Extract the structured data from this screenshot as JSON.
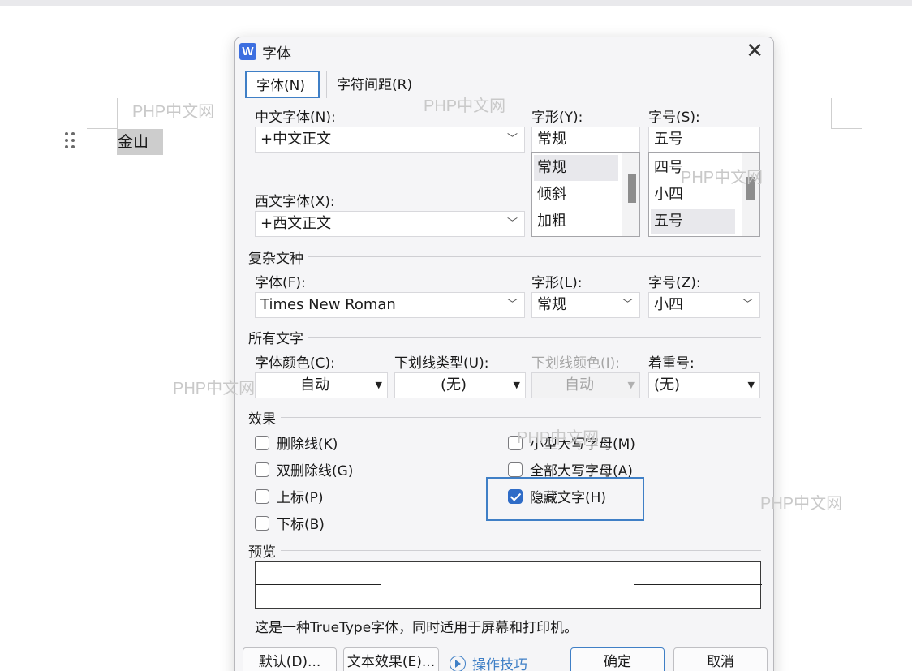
{
  "document": {
    "text": "金山"
  },
  "watermarks": [
    "PHP中文网",
    "PHP中文网",
    "PHP中文网",
    "PHP中文网",
    "PHP中文网",
    "PHP中文网"
  ],
  "dialog": {
    "app_icon": "W",
    "title": "字体",
    "tabs": [
      {
        "label": "字体(N)",
        "active": true
      },
      {
        "label": "字符间距(R)",
        "active": false
      }
    ],
    "chinese_font": {
      "label": "中文字体(N):",
      "value": "+中文正文"
    },
    "font_style": {
      "label": "字形(Y):",
      "value": "常规",
      "options": [
        "常规",
        "倾斜",
        "加粗"
      ],
      "selected": "常规"
    },
    "font_size": {
      "label": "字号(S):",
      "value": "五号",
      "options": [
        "四号",
        "小四",
        "五号"
      ],
      "selected": "五号"
    },
    "western_font": {
      "label": "西文字体(X):",
      "value": "+西文正文"
    },
    "complex": {
      "section": "复杂文种",
      "font_label": "字体(F):",
      "font_value": "Times New Roman",
      "style_label": "字形(L):",
      "style_value": "常规",
      "size_label": "字号(Z):",
      "size_value": "小四"
    },
    "all_text": {
      "section": "所有文字",
      "color_label": "字体颜色(C):",
      "color_value": "自动",
      "underline_label": "下划线类型(U):",
      "underline_value": "(无)",
      "underline_color_label": "下划线颜色(I):",
      "underline_color_value": "自动",
      "emphasis_label": "着重号:",
      "emphasis_value": "(无)"
    },
    "effects": {
      "section": "效果",
      "items": [
        {
          "label": "删除线(K)",
          "checked": false
        },
        {
          "label": "双删除线(G)",
          "checked": false
        },
        {
          "label": "上标(P)",
          "checked": false
        },
        {
          "label": "下标(B)",
          "checked": false
        },
        {
          "label": "小型大写字母(M)",
          "checked": false
        },
        {
          "label": "全部大写字母(A)",
          "checked": false
        },
        {
          "label": "隐藏文字(H)",
          "checked": true
        }
      ]
    },
    "preview": {
      "section": "预览",
      "description": "这是一种TrueType字体，同时适用于屏幕和打印机。"
    },
    "buttons": {
      "default": "默认(D)...",
      "text_effects": "文本效果(E)...",
      "tips": "操作技巧",
      "ok": "确定",
      "cancel": "取消"
    },
    "accent_color": "#3f7fc6"
  }
}
